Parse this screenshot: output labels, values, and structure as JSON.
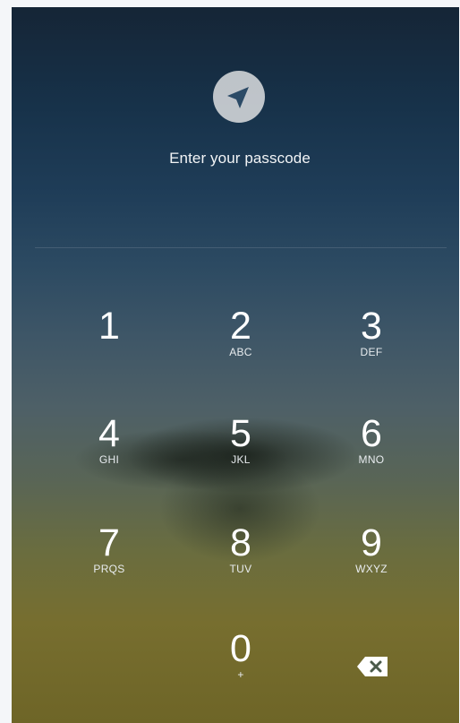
{
  "prompt": "Enter your passcode",
  "keypad": [
    {
      "digit": "1",
      "letters": ""
    },
    {
      "digit": "2",
      "letters": "ABC"
    },
    {
      "digit": "3",
      "letters": "DEF"
    },
    {
      "digit": "4",
      "letters": "GHI"
    },
    {
      "digit": "5",
      "letters": "JKL"
    },
    {
      "digit": "6",
      "letters": "MNO"
    },
    {
      "digit": "7",
      "letters": "PRQS"
    },
    {
      "digit": "8",
      "letters": "TUV"
    },
    {
      "digit": "9",
      "letters": "WXYZ"
    },
    {
      "digit": "0",
      "letters": "+"
    }
  ],
  "icons": {
    "logo": "paper-plane-icon",
    "delete": "backspace-icon"
  },
  "colors": {
    "text": "#ffffff",
    "logo_bg": "#eeeeee",
    "logo_glyph": "#2b4a66"
  }
}
